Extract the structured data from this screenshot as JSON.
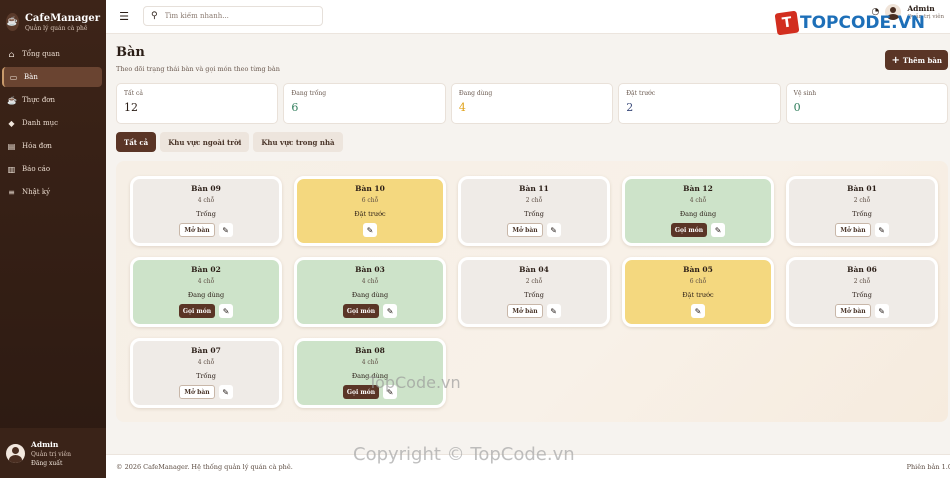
{
  "app": {
    "name": "CafeManager",
    "tagline": "Quản lý quán cà phê"
  },
  "sidebar": {
    "items": [
      {
        "icon": "home-icon",
        "label": "Tổng quan",
        "active": false
      },
      {
        "icon": "chair-icon",
        "label": "Bàn",
        "active": true
      },
      {
        "icon": "coffee-icon",
        "label": "Thực đơn",
        "active": false
      },
      {
        "icon": "tags-icon",
        "label": "Danh mục",
        "active": false
      },
      {
        "icon": "file-icon",
        "label": "Hóa đơn",
        "active": false
      },
      {
        "icon": "chart-icon",
        "label": "Báo cáo",
        "active": false
      },
      {
        "icon": "log-icon",
        "label": "Nhật ký",
        "active": false
      }
    ],
    "user": {
      "name": "Admin",
      "role": "Quản trị viên",
      "logout": "Đăng xuất"
    }
  },
  "topbar": {
    "search_placeholder": "Tìm kiếm nhanh...",
    "user": {
      "name": "Admin",
      "role": "Quản trị viên"
    }
  },
  "page": {
    "title": "Bàn",
    "subtitle": "Theo dõi trạng thái bàn và gọi món theo từng bàn",
    "add_button": "Thêm bàn"
  },
  "stats": [
    {
      "label": "Tất cả",
      "value": "12",
      "color": "#2a1d16"
    },
    {
      "label": "Đang trống",
      "value": "6",
      "color": "#2f7d5b"
    },
    {
      "label": "Đang dùng",
      "value": "4",
      "color": "#e0a21b"
    },
    {
      "label": "Đặt trước",
      "value": "2",
      "color": "#3a4a7a"
    },
    {
      "label": "Vệ sinh",
      "value": "0",
      "color": "#2f7d5b"
    }
  ],
  "tabs": [
    {
      "label": "Tất cả",
      "active": true
    },
    {
      "label": "Khu vực ngoài trời",
      "active": false
    },
    {
      "label": "Khu vực trong nhà",
      "active": false
    }
  ],
  "tables": [
    {
      "name": "Bàn 09",
      "seats": "4 chỗ",
      "status": "Trống",
      "state": "empty",
      "action": "Mở bàn"
    },
    {
      "name": "Bàn 10",
      "seats": "6 chỗ",
      "status": "Đặt trước",
      "state": "reserved",
      "action": ""
    },
    {
      "name": "Bàn 11",
      "seats": "2 chỗ",
      "status": "Trống",
      "state": "empty",
      "action": "Mở bàn"
    },
    {
      "name": "Bàn 12",
      "seats": "4 chỗ",
      "status": "Đang dùng",
      "state": "inuse",
      "action": "Gọi món"
    },
    {
      "name": "Bàn 01",
      "seats": "2 chỗ",
      "status": "Trống",
      "state": "empty",
      "action": "Mở bàn"
    },
    {
      "name": "Bàn 02",
      "seats": "4 chỗ",
      "status": "Đang dùng",
      "state": "inuse",
      "action": "Gọi món"
    },
    {
      "name": "Bàn 03",
      "seats": "4 chỗ",
      "status": "Đang dùng",
      "state": "inuse",
      "action": "Gọi món"
    },
    {
      "name": "Bàn 04",
      "seats": "2 chỗ",
      "status": "Trống",
      "state": "empty",
      "action": "Mở bàn"
    },
    {
      "name": "Bàn 05",
      "seats": "6 chỗ",
      "status": "Đặt trước",
      "state": "reserved",
      "action": ""
    },
    {
      "name": "Bàn 06",
      "seats": "2 chỗ",
      "status": "Trống",
      "state": "empty",
      "action": "Mở bàn"
    },
    {
      "name": "Bàn 07",
      "seats": "4 chỗ",
      "status": "Trống",
      "state": "empty",
      "action": "Mở bàn"
    },
    {
      "name": "Bàn 08",
      "seats": "4 chỗ",
      "status": "Đang dùng",
      "state": "inuse",
      "action": "Gọi món"
    }
  ],
  "footer": {
    "copyright": "© 2026 CafeManager. Hệ thống quản lý quán cà phê.",
    "version": "Phiên bản 1.0"
  },
  "watermarks": {
    "logo_text": "TOPCODE.VN",
    "logo_mark": "T",
    "middle": "TopCode.vn",
    "bottom": "Copyright © TopCode.vn"
  }
}
